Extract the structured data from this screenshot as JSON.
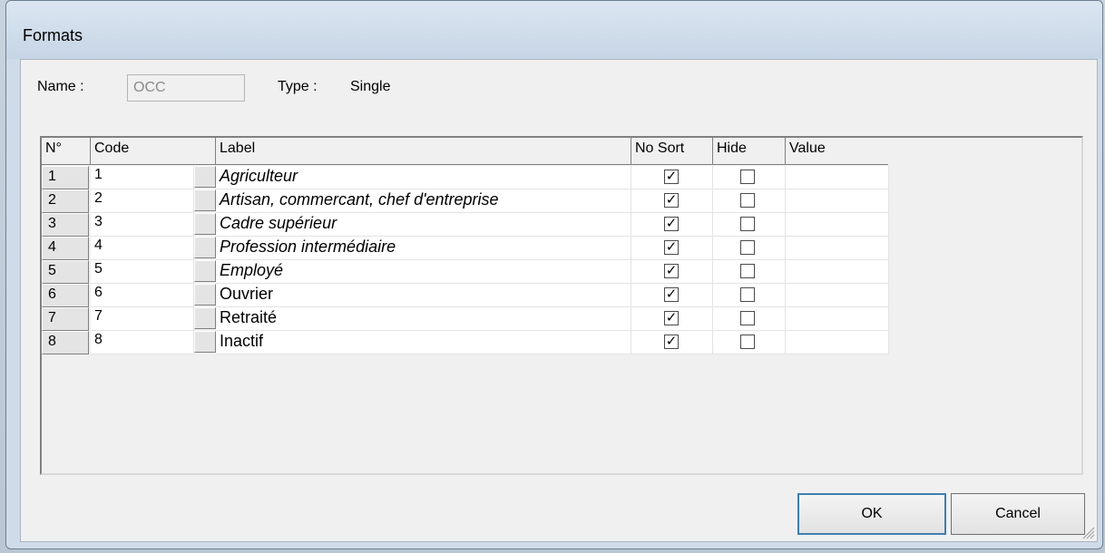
{
  "window": {
    "title": "Formats"
  },
  "form": {
    "name_label": "Name :",
    "name_value": "OCC",
    "type_label": "Type :",
    "type_value": "Single"
  },
  "grid": {
    "headers": [
      "N°",
      "Code",
      "Label",
      "No Sort",
      "Hide",
      "Value"
    ],
    "rows": [
      {
        "n": "1",
        "code": "1",
        "label": "Agriculteur",
        "italic": true,
        "no_sort": true,
        "hide": false,
        "value": ""
      },
      {
        "n": "2",
        "code": "2",
        "label": "Artisan, commercant, chef d'entreprise",
        "italic": true,
        "no_sort": true,
        "hide": false,
        "value": ""
      },
      {
        "n": "3",
        "code": "3",
        "label": "Cadre supérieur",
        "italic": true,
        "no_sort": true,
        "hide": false,
        "value": ""
      },
      {
        "n": "4",
        "code": "4",
        "label": "Profession intermédiaire",
        "italic": true,
        "no_sort": true,
        "hide": false,
        "value": ""
      },
      {
        "n": "5",
        "code": "5",
        "label": "Employé",
        "italic": true,
        "no_sort": true,
        "hide": false,
        "value": ""
      },
      {
        "n": "6",
        "code": "6",
        "label": "Ouvrier",
        "italic": false,
        "no_sort": true,
        "hide": false,
        "value": ""
      },
      {
        "n": "7",
        "code": "7",
        "label": "Retraité",
        "italic": false,
        "no_sort": true,
        "hide": false,
        "value": ""
      },
      {
        "n": "8",
        "code": "8",
        "label": "Inactif",
        "italic": false,
        "no_sort": true,
        "hide": false,
        "value": ""
      }
    ]
  },
  "buttons": {
    "ok": "OK",
    "cancel": "Cancel"
  },
  "icons": {
    "check": "✓",
    "resize": "resize-grip-icon"
  },
  "colors": {
    "frame": "#cfdbe8",
    "client": "#f0f0f0",
    "ok_border": "#3c7fb1"
  }
}
